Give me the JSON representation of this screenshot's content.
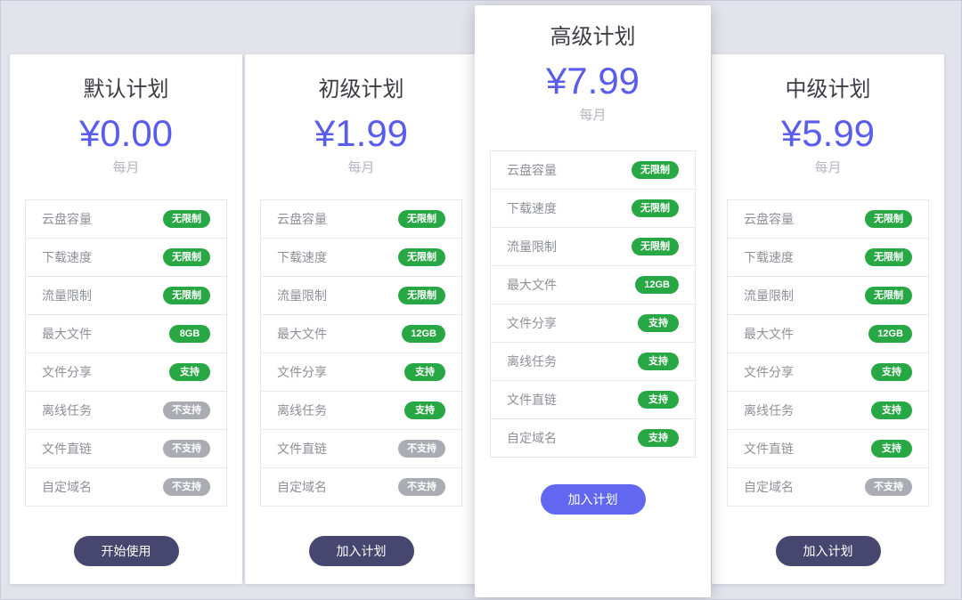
{
  "colors": {
    "page_background": "#e3e4eb",
    "price_text": "#5a5cec",
    "badge_supported": "#28a745",
    "badge_unsupported": "#abacb3",
    "button_dark": "#46466e",
    "button_accent": "#6267f1"
  },
  "plans": [
    {
      "name": "默认计划",
      "price": "¥0.00",
      "period": "每月",
      "button_label": "开始使用",
      "button_style": "dark",
      "featured": false,
      "features": [
        {
          "label": "云盘容量",
          "badge": "无限制",
          "badge_color": "green"
        },
        {
          "label": "下载速度",
          "badge": "无限制",
          "badge_color": "green"
        },
        {
          "label": "流量限制",
          "badge": "无限制",
          "badge_color": "green"
        },
        {
          "label": "最大文件",
          "badge": "8GB",
          "badge_color": "green"
        },
        {
          "label": "文件分享",
          "badge": "支持",
          "badge_color": "green"
        },
        {
          "label": "离线任务",
          "badge": "不支持",
          "badge_color": "gray"
        },
        {
          "label": "文件直链",
          "badge": "不支持",
          "badge_color": "gray"
        },
        {
          "label": "自定域名",
          "badge": "不支持",
          "badge_color": "gray"
        }
      ]
    },
    {
      "name": "初级计划",
      "price": "¥1.99",
      "period": "每月",
      "button_label": "加入计划",
      "button_style": "dark",
      "featured": false,
      "features": [
        {
          "label": "云盘容量",
          "badge": "无限制",
          "badge_color": "green"
        },
        {
          "label": "下载速度",
          "badge": "无限制",
          "badge_color": "green"
        },
        {
          "label": "流量限制",
          "badge": "无限制",
          "badge_color": "green"
        },
        {
          "label": "最大文件",
          "badge": "12GB",
          "badge_color": "green"
        },
        {
          "label": "文件分享",
          "badge": "支持",
          "badge_color": "green"
        },
        {
          "label": "离线任务",
          "badge": "支持",
          "badge_color": "green"
        },
        {
          "label": "文件直链",
          "badge": "不支持",
          "badge_color": "gray"
        },
        {
          "label": "自定域名",
          "badge": "不支持",
          "badge_color": "gray"
        }
      ]
    },
    {
      "name": "高级计划",
      "price": "¥7.99",
      "period": "每月",
      "button_label": "加入计划",
      "button_style": "accent",
      "featured": true,
      "features": [
        {
          "label": "云盘容量",
          "badge": "无限制",
          "badge_color": "green"
        },
        {
          "label": "下载速度",
          "badge": "无限制",
          "badge_color": "green"
        },
        {
          "label": "流量限制",
          "badge": "无限制",
          "badge_color": "green"
        },
        {
          "label": "最大文件",
          "badge": "12GB",
          "badge_color": "green"
        },
        {
          "label": "文件分享",
          "badge": "支持",
          "badge_color": "green"
        },
        {
          "label": "离线任务",
          "badge": "支持",
          "badge_color": "green"
        },
        {
          "label": "文件直链",
          "badge": "支持",
          "badge_color": "green"
        },
        {
          "label": "自定域名",
          "badge": "支持",
          "badge_color": "green"
        }
      ]
    },
    {
      "name": "中级计划",
      "price": "¥5.99",
      "period": "每月",
      "button_label": "加入计划",
      "button_style": "dark",
      "featured": false,
      "features": [
        {
          "label": "云盘容量",
          "badge": "无限制",
          "badge_color": "green"
        },
        {
          "label": "下载速度",
          "badge": "无限制",
          "badge_color": "green"
        },
        {
          "label": "流量限制",
          "badge": "无限制",
          "badge_color": "green"
        },
        {
          "label": "最大文件",
          "badge": "12GB",
          "badge_color": "green"
        },
        {
          "label": "文件分享",
          "badge": "支持",
          "badge_color": "green"
        },
        {
          "label": "离线任务",
          "badge": "支持",
          "badge_color": "green"
        },
        {
          "label": "文件直链",
          "badge": "支持",
          "badge_color": "green"
        },
        {
          "label": "自定域名",
          "badge": "不支持",
          "badge_color": "gray"
        }
      ]
    }
  ]
}
